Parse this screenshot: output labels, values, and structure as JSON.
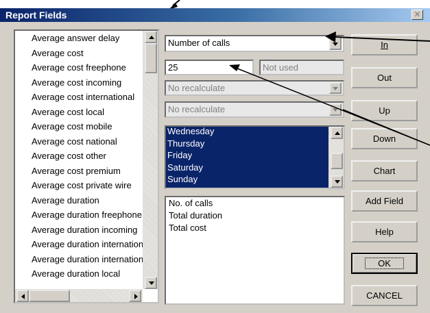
{
  "window": {
    "title": "Report Fields"
  },
  "fields_list": {
    "items": [
      "Average answer delay",
      "Average cost",
      "Average cost freephone",
      "Average cost incoming",
      "Average cost international",
      "Average cost local",
      "Average cost mobile",
      "Average cost national",
      "Average cost other",
      "Average cost premium",
      "Average cost private wire",
      "Average duration",
      "Average duration freephone",
      "Average duration incoming",
      "Average duration international",
      "Average duration international",
      "Average duration local"
    ]
  },
  "controls": {
    "measure_select": "Number of calls",
    "count_input": "25",
    "count_side": "Not used",
    "recalc_1": "No recalculate",
    "recalc_2": "No recalculate"
  },
  "days_list": {
    "items": [
      "Wednesday",
      "Thursday",
      "Friday",
      "Saturday",
      "Sunday"
    ]
  },
  "selected_fields": {
    "items": [
      "No. of calls",
      "Total duration",
      "Total cost"
    ]
  },
  "buttons": {
    "in": "In",
    "out": "Out",
    "up": "Up",
    "down": "Down",
    "chart": "Chart",
    "add_field": "Add Field",
    "help": "Help",
    "ok": "OK",
    "cancel": "CANCEL"
  },
  "icons": {
    "close": "close-icon",
    "scroll_up": "arrow-up-icon",
    "scroll_down": "arrow-down-icon",
    "scroll_left": "arrow-left-icon",
    "scroll_right": "arrow-right-icon",
    "dropdown": "chevron-down-icon"
  },
  "colors": {
    "title_start": "#0a246a",
    "title_end": "#a6caf0",
    "selection": "#0a246a",
    "face": "#d4d0c8"
  }
}
